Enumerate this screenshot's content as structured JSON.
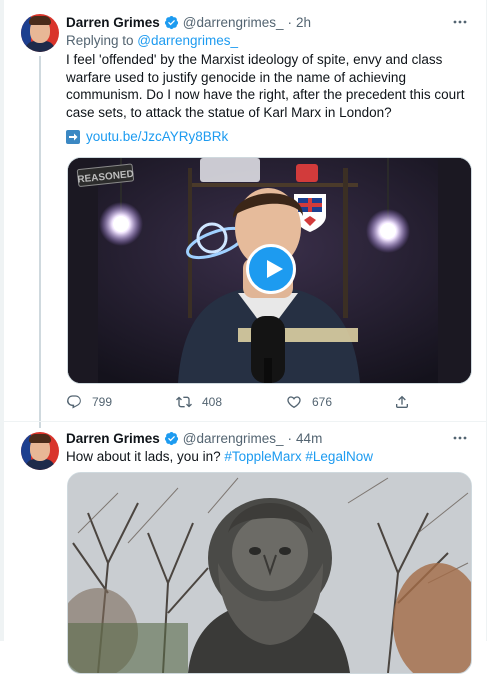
{
  "tweets": [
    {
      "name": "Darren Grimes",
      "handle": "@darrengrimes_",
      "separator": "·",
      "time": "2h",
      "reply_prefix": "Replying to ",
      "reply_mention": "@darrengrimes_",
      "text": "I feel 'offended' by the Marxist ideology of spite, envy and class warfare used to justify genocide in the name of achieving communism. Do I now have the right, after the precedent this court case sets, to attack the statue of Karl Marx in London?",
      "link": "youtu.be/JzcAYRy8BRk",
      "video_watermark": "REASONED",
      "stats": {
        "replies": "799",
        "retweets": "408",
        "likes": "676"
      }
    },
    {
      "name": "Darren Grimes",
      "handle": "@darrengrimes_",
      "separator": "·",
      "time": "44m",
      "text_prefix": "How about it lads, you in? ",
      "hashtag1": "#ToppleMarx",
      "hashtag2": "#LegalNow"
    }
  ],
  "colors": {
    "accent": "#1d9bf0",
    "text": "#0f1419",
    "muted": "#536471",
    "border": "#eff3f4"
  },
  "icons": [
    "verified-badge-icon",
    "more-options-icon",
    "play-icon",
    "reply-icon",
    "retweet-icon",
    "like-icon",
    "share-icon",
    "arrow-right-icon"
  ]
}
